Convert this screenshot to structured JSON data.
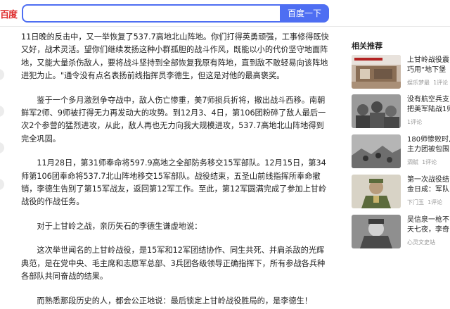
{
  "header": {
    "logo_text": "百度",
    "search_value": "",
    "search_button": "百度一下"
  },
  "article": {
    "paragraphs": [
      "11日晚的反击中，又一举恢复了537.7高地北山阵地。你们打得英勇顽强，工事修得既快又好，战术灵活。望你们继续发扬这种小群孤胆的战斗作风，既能以小的代价坚守地面阵地，又能大量杀伤敌人，要将战斗坚持到全部恢复我原有阵地，直到敌不敢轻易向该阵地进犯为止。\"通令没有点名表扬前线指挥员李德生，但这是对他的最高褒奖。",
      "鉴于一个多月激烈争夺战中，敌人伤亡惨重，美7师损兵折将，撤出战斗西移。南朝鲜军2师、9师被打得无力再发动大的攻势。到12月3、4日，第106团粉碎了敌人最后一次2个参营的猛烈进攻，从此，敌人再也无力向我大规模进攻，537.7高地北山阵地得到完全巩固。",
      "11月28日，第31师奉命将597.9高地之全部防务移交15军部队。12月15日，第34师第106团奉命将537.7北山阵地移交15军部队。战役结束，五圣山前线指挥所奉命撤销，李德生告别了第15军战友，返回第12军工作。至此，第12军圆满完成了参加上甘岭战役的作战任务。",
      "对于上甘岭之战，亲历矢石的李德生谦虚地说：",
      "这次举世闻名的上甘岭战役，是15军和12军团结协作、同生共死、并肩杀敌的光辉典范，是在党中央、毛主席和志愿军总部、3兵团各级领导正确指挥下，所有参战各兵种各部队共同奋战的结果。",
      "而熟悉那段历史的人，都会公正地说：最后锁定上甘岭战役胜局的，是李德生！"
    ]
  },
  "sidebar": {
    "title": "相关推荐",
    "items": [
      {
        "title": "上甘岭战役震",
        "subtitle": "巧用“地下堡",
        "meta": "娱乐梦最",
        "comments": "1评论"
      },
      {
        "title": "没有航空兵支",
        "subtitle": "把美军陆战1师",
        "meta": "",
        "comments": "1评论"
      },
      {
        "title": "180师惨败时,",
        "subtitle": "主力团被包围",
        "meta": "泗赋",
        "comments": "1评论"
      },
      {
        "title": "第一次战役结",
        "subtitle": "金日成：军队",
        "meta": "下门玉",
        "comments": "1评论"
      },
      {
        "title": "吴信泉一枪不",
        "subtitle": "天七夜，李奇",
        "meta": "心灵文史站",
        "comments": ""
      }
    ]
  }
}
